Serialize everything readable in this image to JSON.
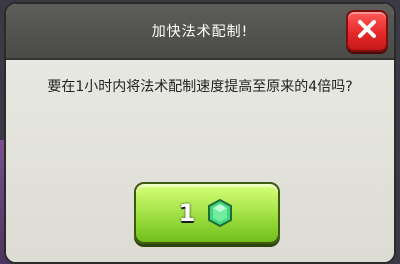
{
  "dialog": {
    "title": "加快法术配制!",
    "message": "要在1小时内将法术配制速度提高至原来的4倍吗?",
    "confirm_value": "1",
    "confirm_icon": "gem-icon",
    "close_icon": "close-icon"
  },
  "colors": {
    "header": "#4f4f4c",
    "content": "#e2e2dc",
    "close_button": "#e62a2a",
    "confirm_button": "#a9e64b",
    "gem": "#3fd87a"
  }
}
